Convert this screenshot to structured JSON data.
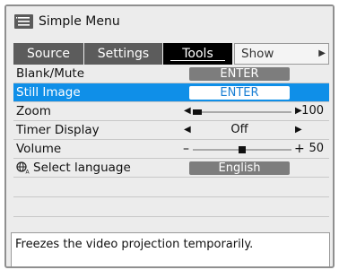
{
  "window": {
    "title": "Simple Menu",
    "icon": "menu-list-icon"
  },
  "tabs": [
    {
      "label": "Source",
      "active": false
    },
    {
      "label": "Settings",
      "active": false
    },
    {
      "label": "Tools",
      "active": true
    },
    {
      "label": "Show Advanced",
      "active": false
    }
  ],
  "rows": {
    "blank_mute": {
      "label": "Blank/Mute",
      "button": "ENTER"
    },
    "still_image": {
      "label": "Still Image",
      "button": "ENTER",
      "selected": true
    },
    "zoom": {
      "label": "Zoom",
      "value": "100"
    },
    "timer_display": {
      "label": "Timer Display",
      "value": "Off"
    },
    "volume": {
      "label": "Volume",
      "value": "50"
    },
    "language": {
      "label": "Select language",
      "button": "English",
      "icon": "globe-language-icon"
    }
  },
  "description": "Freezes the video projection temporarily.",
  "colors": {
    "selection": "#0f8fe8",
    "active_tab": "#000000",
    "tab": "#5c5c5c",
    "panel": "#ececec"
  }
}
